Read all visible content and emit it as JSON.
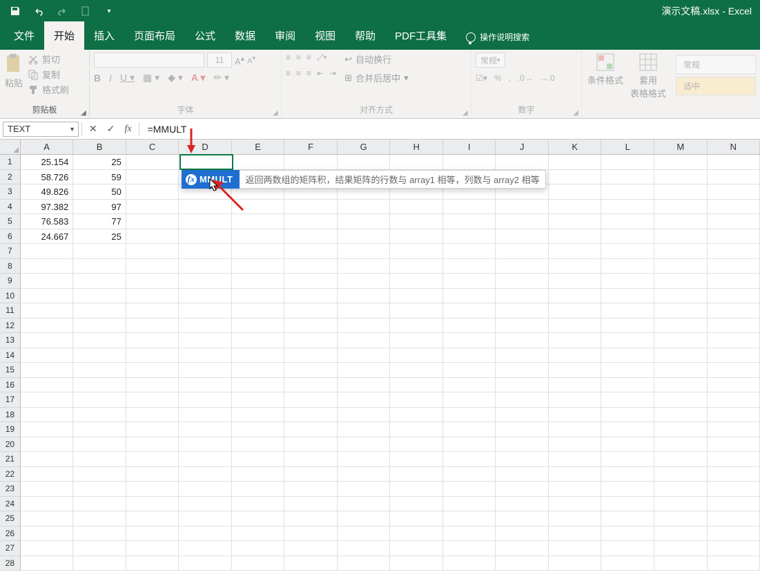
{
  "title_bar": {
    "doc_title": "演示文稿.xlsx  -  Excel"
  },
  "tabs": {
    "file": "文件",
    "home": "开始",
    "insert": "插入",
    "page_layout": "页面布局",
    "formulas": "公式",
    "data": "数据",
    "review": "审阅",
    "view": "视图",
    "help": "帮助",
    "pdf": "PDF工具集",
    "tell_me": "操作说明搜索"
  },
  "ribbon": {
    "clipboard": {
      "label": "剪贴板",
      "paste": "粘贴",
      "cut": "剪切",
      "copy": "复制",
      "format_painter": "格式刷"
    },
    "font": {
      "label": "字体",
      "size": "11"
    },
    "alignment": {
      "label": "对齐方式",
      "wrap": "自动换行",
      "merge": "合并后居中"
    },
    "number": {
      "label": "数字",
      "format": "常规"
    },
    "styles": {
      "cond": "条件格式",
      "table": "套用\n表格格式"
    },
    "cellstyles": {
      "normal": "常规",
      "good": "适中"
    }
  },
  "formula_bar": {
    "name_box": "TEXT",
    "cancel": "✕",
    "enter": "✓",
    "formula": "=MMULT"
  },
  "columns": [
    "A",
    "B",
    "C",
    "D",
    "E",
    "F",
    "G",
    "H",
    "I",
    "J",
    "K",
    "L",
    "M",
    "N"
  ],
  "rows": {
    "1": {
      "A": "25.154",
      "B": "25",
      "D": "=MMULT"
    },
    "2": {
      "A": "58.726",
      "B": "59"
    },
    "3": {
      "A": "49.826",
      "B": "50"
    },
    "4": {
      "A": "97.382",
      "B": "97"
    },
    "5": {
      "A": "76.583",
      "B": "77"
    },
    "6": {
      "A": "24.667",
      "B": "25"
    }
  },
  "row_count": 28,
  "autocomplete": {
    "item": "MMULT",
    "description": "返回两数组的矩阵积，结果矩阵的行数与 array1 相等，列数与 array2 相等"
  }
}
